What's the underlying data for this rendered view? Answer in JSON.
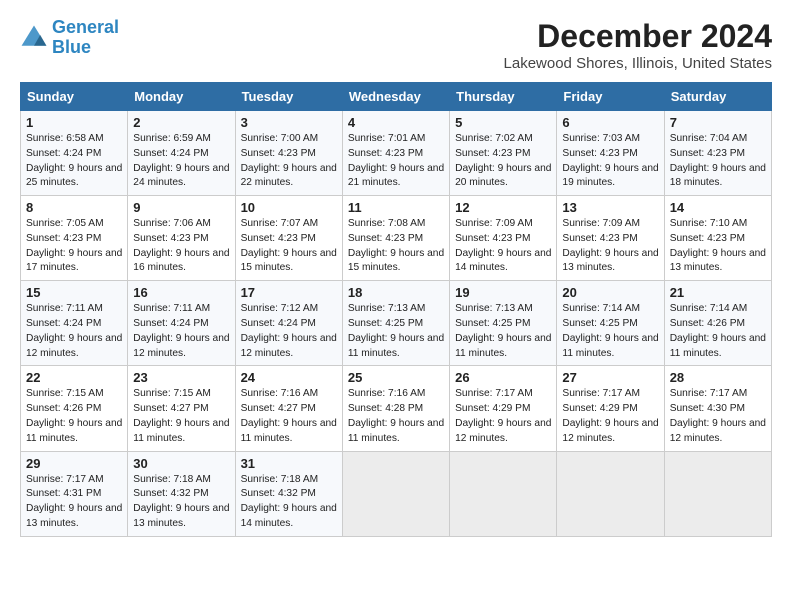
{
  "header": {
    "logo_line1": "General",
    "logo_line2": "Blue",
    "month_title": "December 2024",
    "location": "Lakewood Shores, Illinois, United States"
  },
  "days_of_week": [
    "Sunday",
    "Monday",
    "Tuesday",
    "Wednesday",
    "Thursday",
    "Friday",
    "Saturday"
  ],
  "weeks": [
    [
      {
        "day": "1",
        "sunrise": "6:58 AM",
        "sunset": "4:24 PM",
        "daylight": "9 hours and 25 minutes."
      },
      {
        "day": "2",
        "sunrise": "6:59 AM",
        "sunset": "4:24 PM",
        "daylight": "9 hours and 24 minutes."
      },
      {
        "day": "3",
        "sunrise": "7:00 AM",
        "sunset": "4:23 PM",
        "daylight": "9 hours and 22 minutes."
      },
      {
        "day": "4",
        "sunrise": "7:01 AM",
        "sunset": "4:23 PM",
        "daylight": "9 hours and 21 minutes."
      },
      {
        "day": "5",
        "sunrise": "7:02 AM",
        "sunset": "4:23 PM",
        "daylight": "9 hours and 20 minutes."
      },
      {
        "day": "6",
        "sunrise": "7:03 AM",
        "sunset": "4:23 PM",
        "daylight": "9 hours and 19 minutes."
      },
      {
        "day": "7",
        "sunrise": "7:04 AM",
        "sunset": "4:23 PM",
        "daylight": "9 hours and 18 minutes."
      }
    ],
    [
      {
        "day": "8",
        "sunrise": "7:05 AM",
        "sunset": "4:23 PM",
        "daylight": "9 hours and 17 minutes."
      },
      {
        "day": "9",
        "sunrise": "7:06 AM",
        "sunset": "4:23 PM",
        "daylight": "9 hours and 16 minutes."
      },
      {
        "day": "10",
        "sunrise": "7:07 AM",
        "sunset": "4:23 PM",
        "daylight": "9 hours and 15 minutes."
      },
      {
        "day": "11",
        "sunrise": "7:08 AM",
        "sunset": "4:23 PM",
        "daylight": "9 hours and 15 minutes."
      },
      {
        "day": "12",
        "sunrise": "7:09 AM",
        "sunset": "4:23 PM",
        "daylight": "9 hours and 14 minutes."
      },
      {
        "day": "13",
        "sunrise": "7:09 AM",
        "sunset": "4:23 PM",
        "daylight": "9 hours and 13 minutes."
      },
      {
        "day": "14",
        "sunrise": "7:10 AM",
        "sunset": "4:23 PM",
        "daylight": "9 hours and 13 minutes."
      }
    ],
    [
      {
        "day": "15",
        "sunrise": "7:11 AM",
        "sunset": "4:24 PM",
        "daylight": "9 hours and 12 minutes."
      },
      {
        "day": "16",
        "sunrise": "7:11 AM",
        "sunset": "4:24 PM",
        "daylight": "9 hours and 12 minutes."
      },
      {
        "day": "17",
        "sunrise": "7:12 AM",
        "sunset": "4:24 PM",
        "daylight": "9 hours and 12 minutes."
      },
      {
        "day": "18",
        "sunrise": "7:13 AM",
        "sunset": "4:25 PM",
        "daylight": "9 hours and 11 minutes."
      },
      {
        "day": "19",
        "sunrise": "7:13 AM",
        "sunset": "4:25 PM",
        "daylight": "9 hours and 11 minutes."
      },
      {
        "day": "20",
        "sunrise": "7:14 AM",
        "sunset": "4:25 PM",
        "daylight": "9 hours and 11 minutes."
      },
      {
        "day": "21",
        "sunrise": "7:14 AM",
        "sunset": "4:26 PM",
        "daylight": "9 hours and 11 minutes."
      }
    ],
    [
      {
        "day": "22",
        "sunrise": "7:15 AM",
        "sunset": "4:26 PM",
        "daylight": "9 hours and 11 minutes."
      },
      {
        "day": "23",
        "sunrise": "7:15 AM",
        "sunset": "4:27 PM",
        "daylight": "9 hours and 11 minutes."
      },
      {
        "day": "24",
        "sunrise": "7:16 AM",
        "sunset": "4:27 PM",
        "daylight": "9 hours and 11 minutes."
      },
      {
        "day": "25",
        "sunrise": "7:16 AM",
        "sunset": "4:28 PM",
        "daylight": "9 hours and 11 minutes."
      },
      {
        "day": "26",
        "sunrise": "7:17 AM",
        "sunset": "4:29 PM",
        "daylight": "9 hours and 12 minutes."
      },
      {
        "day": "27",
        "sunrise": "7:17 AM",
        "sunset": "4:29 PM",
        "daylight": "9 hours and 12 minutes."
      },
      {
        "day": "28",
        "sunrise": "7:17 AM",
        "sunset": "4:30 PM",
        "daylight": "9 hours and 12 minutes."
      }
    ],
    [
      {
        "day": "29",
        "sunrise": "7:17 AM",
        "sunset": "4:31 PM",
        "daylight": "9 hours and 13 minutes."
      },
      {
        "day": "30",
        "sunrise": "7:18 AM",
        "sunset": "4:32 PM",
        "daylight": "9 hours and 13 minutes."
      },
      {
        "day": "31",
        "sunrise": "7:18 AM",
        "sunset": "4:32 PM",
        "daylight": "9 hours and 14 minutes."
      },
      null,
      null,
      null,
      null
    ]
  ],
  "labels": {
    "sunrise": "Sunrise:",
    "sunset": "Sunset:",
    "daylight": "Daylight:"
  }
}
